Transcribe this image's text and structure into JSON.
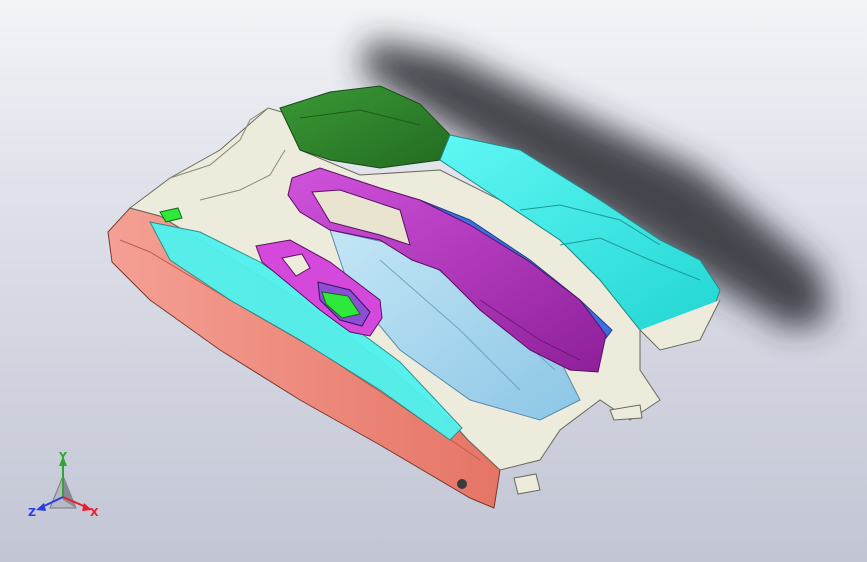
{
  "viewport": {
    "background_top": "#f3f4f8",
    "background_bottom": "#c2c5d4"
  },
  "model": {
    "colors": {
      "salmon_rim": "#f08a7c",
      "cream_body": "#ecebdc",
      "cyan_cover": "#33f0ec",
      "green_top": "#2f8a2c",
      "magenta_armrest": "#b82fc4",
      "light_blue_floor": "#a9d6ee",
      "bright_green_insert": "#2ee83a",
      "blue_strip": "#3d6fe0"
    }
  },
  "triad": {
    "x_label": "X",
    "y_label": "Y",
    "z_label": "Z",
    "x_color": "#e8202a",
    "y_color": "#2fa82f",
    "z_color": "#2a3fe0",
    "icon": "coordinate-triad-icon"
  }
}
